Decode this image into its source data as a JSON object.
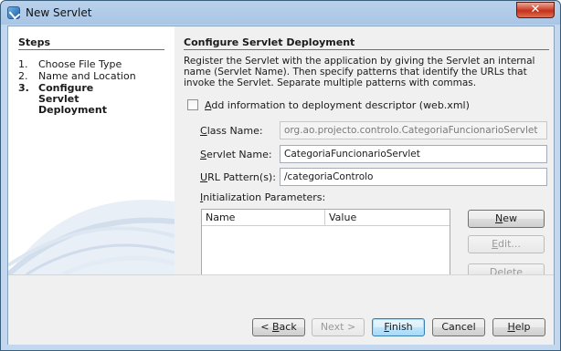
{
  "window": {
    "title": "New Servlet",
    "close_glyph": "✕"
  },
  "steps": {
    "title": "Steps",
    "items": [
      {
        "num": "1.",
        "label": "Choose File Type"
      },
      {
        "num": "2.",
        "label": "Name and Location"
      },
      {
        "num": "3.",
        "label": "Configure Servlet Deployment",
        "current": true
      }
    ]
  },
  "content": {
    "title": "Configure Servlet Deployment",
    "description": "Register the Servlet with the application by giving the Servlet an internal name (Servlet Name). Then specify patterns that identify the URLs that invoke the Servlet. Separate multiple patterns with commas.",
    "checkbox": {
      "label_mnemonic": "A",
      "label_rest": "dd information to deployment descriptor (web.xml)",
      "checked": false
    },
    "class_name": {
      "label_mnemonic": "C",
      "label_rest": "lass Name:",
      "value": "org.ao.projecto.controlo.CategoriaFuncionarioServlet"
    },
    "servlet_name": {
      "label_mnemonic": "S",
      "label_rest": "ervlet Name:",
      "value": "CategoriaFuncionarioServlet"
    },
    "url_pattern": {
      "label_mnemonic": "U",
      "label_rest": "RL Pattern(s):",
      "value": "/categoriaControlo"
    },
    "init_params": {
      "label_mnemonic": "I",
      "label_rest": "nitialization Parameters:",
      "columns": [
        "Name",
        "Value"
      ]
    },
    "param_buttons": {
      "new": {
        "mnemonic": "N",
        "rest": "ew"
      },
      "edit": {
        "mnemonic": "E",
        "rest": "dit..."
      },
      "delete": "Delete"
    }
  },
  "footer": {
    "back": {
      "prefix": "< ",
      "mnemonic": "B",
      "rest": "ack"
    },
    "next": "Next >",
    "finish": {
      "mnemonic": "F",
      "rest": "inish"
    },
    "cancel": "Cancel",
    "help": {
      "mnemonic": "H",
      "rest": "elp"
    }
  },
  "colors": {
    "titlebar": "#a9c6e6",
    "default_button": "#bee6fd"
  }
}
